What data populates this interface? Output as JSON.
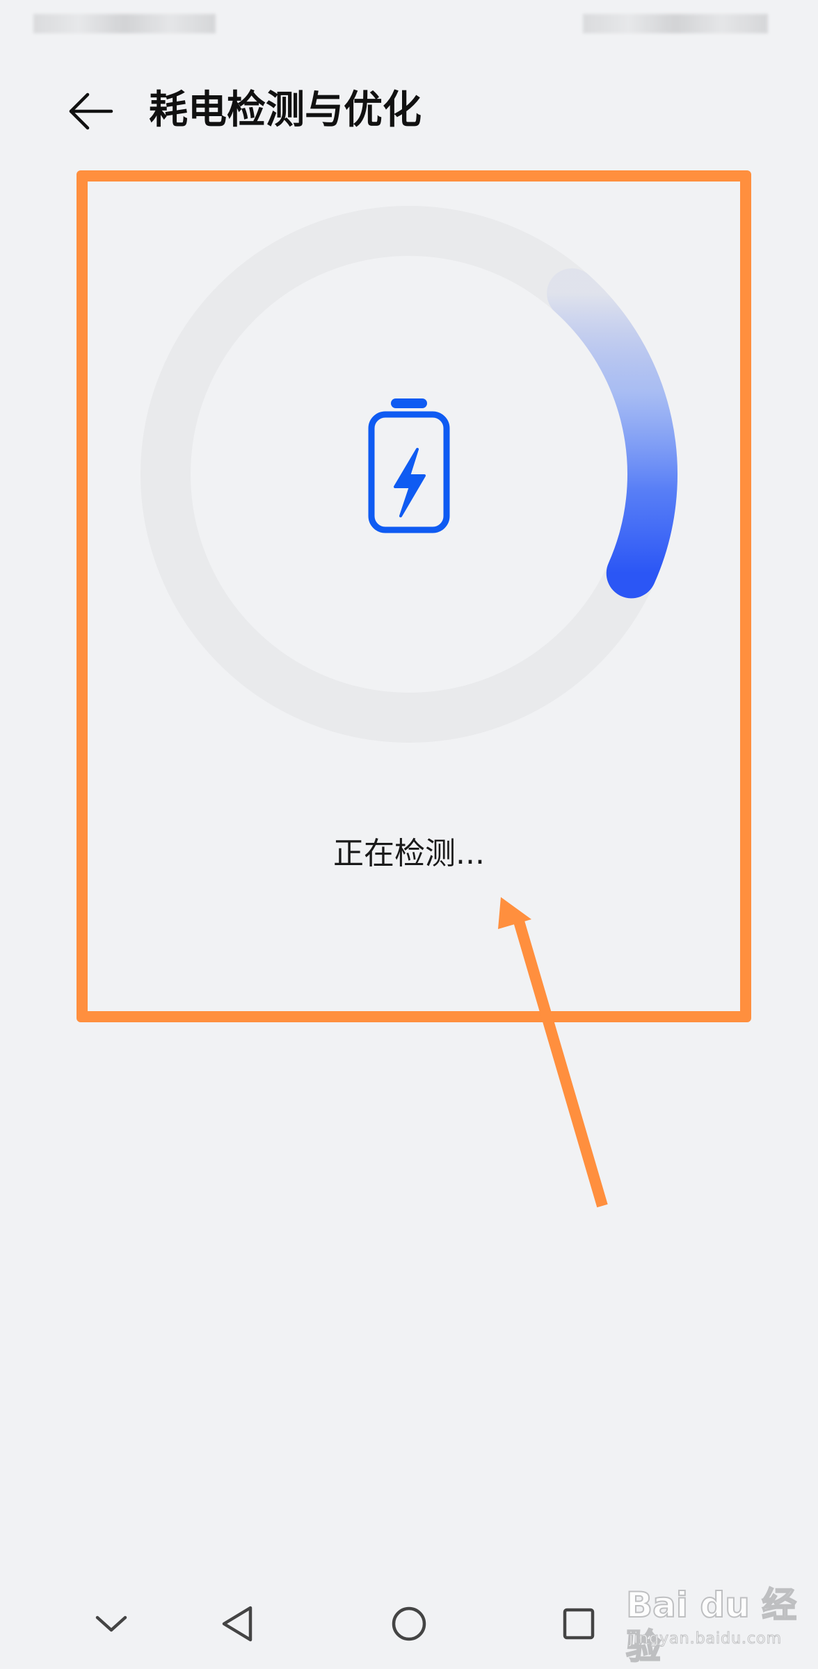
{
  "header": {
    "title": "耗电检测与优化",
    "back_icon": "arrow-left-icon"
  },
  "detection": {
    "status_text": "正在检测...",
    "battery_icon": "battery-charging-icon",
    "progress_fraction": 0.2,
    "progress_color": "#2b56f5",
    "track_color": "#e9eaec"
  },
  "annotation": {
    "box_color": "#ff8f3e",
    "arrow_color": "#ff8f3e"
  },
  "nav_bar": {
    "icons": [
      "chevron-down-icon",
      "back-triangle-icon",
      "home-circle-icon",
      "recent-square-icon"
    ]
  },
  "watermark": {
    "logo": "Bai du 经验",
    "url": "jingyan.baidu.com"
  }
}
